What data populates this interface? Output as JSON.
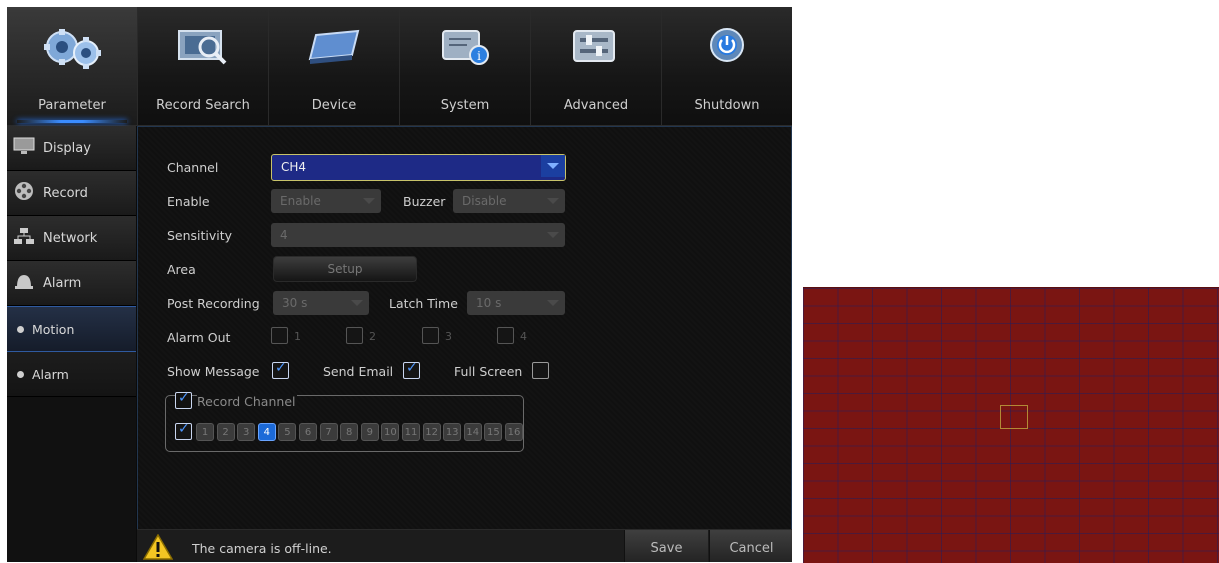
{
  "nav": {
    "tabs": [
      {
        "label": "Parameter",
        "icon": "gears-icon"
      },
      {
        "label": "Record Search",
        "icon": "film-search-icon"
      },
      {
        "label": "Device",
        "icon": "hard-drive-icon"
      },
      {
        "label": "System",
        "icon": "system-info-icon"
      },
      {
        "label": "Advanced",
        "icon": "sliders-icon"
      },
      {
        "label": "Shutdown",
        "icon": "power-icon"
      }
    ],
    "active": "Parameter"
  },
  "sidebar": {
    "items": [
      {
        "label": "Display",
        "icon": "monitor-icon"
      },
      {
        "label": "Record",
        "icon": "film-reel-icon"
      },
      {
        "label": "Network",
        "icon": "network-icon"
      },
      {
        "label": "Alarm",
        "icon": "bell-icon"
      },
      {
        "label": "Motion",
        "icon": "bullet-icon",
        "active": true
      },
      {
        "label": "Alarm",
        "icon": "bullet-icon"
      }
    ]
  },
  "form": {
    "channel_label": "Channel",
    "channel_value": "CH4",
    "enable_label": "Enable",
    "enable_value": "Enable",
    "buzzer_label": "Buzzer",
    "buzzer_value": "Disable",
    "sensitivity_label": "Sensitivity",
    "sensitivity_value": "4",
    "area_label": "Area",
    "setup_label": "Setup",
    "post_recording_label": "Post Recording",
    "post_recording_value": "30 s",
    "latch_time_label": "Latch Time",
    "latch_time_value": "10 s",
    "alarm_out_label": "Alarm Out",
    "alarm_out": [
      "1",
      "2",
      "3",
      "4"
    ],
    "show_message_label": "Show Message",
    "show_message_checked": true,
    "send_email_label": "Send Email",
    "send_email_checked": true,
    "full_screen_label": "Full Screen",
    "full_screen_checked": false,
    "record_channel_label": "Record Channel",
    "record_channel_checked": true,
    "channels": [
      "1",
      "2",
      "3",
      "4",
      "5",
      "6",
      "7",
      "8",
      "9",
      "10",
      "11",
      "12",
      "13",
      "14",
      "15",
      "16"
    ],
    "selected_channel": "4"
  },
  "status": {
    "message": "The camera is off-line.",
    "save_label": "Save",
    "cancel_label": "Cancel"
  },
  "colors": {
    "accent": "#3a8cff",
    "preview_bg": "#7a1512",
    "selected_cell": "#b28a36"
  }
}
